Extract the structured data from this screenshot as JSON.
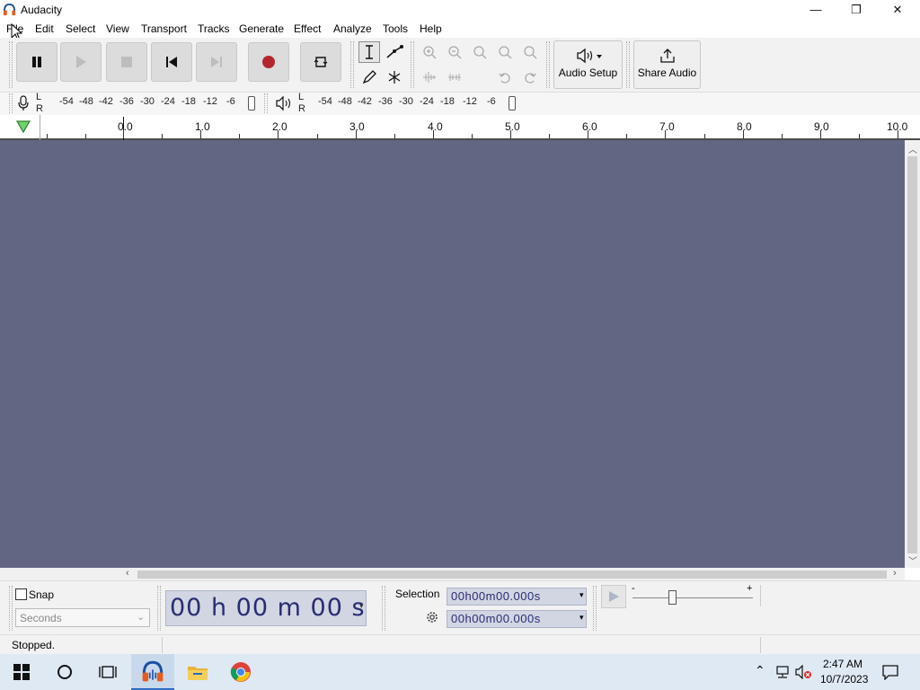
{
  "window": {
    "title": "Audacity",
    "minimize": "—",
    "maximize": "❐",
    "close": "✕"
  },
  "menu": [
    "File",
    "Edit",
    "Select",
    "View",
    "Transport",
    "Tracks",
    "Generate",
    "Effect",
    "Analyze",
    "Tools",
    "Help"
  ],
  "toolbar": {
    "audio_setup_label": "Audio Setup",
    "share_audio_label": "Share Audio"
  },
  "meters": {
    "record_lr": [
      "L",
      "R"
    ],
    "record_scale": [
      "-54",
      "-48",
      "-42",
      "-36",
      "-30",
      "-24",
      "-18",
      "-12",
      "-6"
    ],
    "play_lr": [
      "L",
      "R"
    ],
    "play_scale": [
      "-54",
      "-48",
      "-42",
      "-36",
      "-30",
      "-24",
      "-18",
      "-12",
      "-6"
    ]
  },
  "ruler": {
    "labels": [
      "0.0",
      "1.0",
      "2.0",
      "3.0",
      "4.0",
      "5.0",
      "6.0",
      "7.0",
      "8.0",
      "9.0",
      "10.0"
    ]
  },
  "snap": {
    "label": "Snap",
    "checked": false,
    "unit": "Seconds"
  },
  "time": {
    "h": "00",
    "h_unit": "h",
    "m": "00",
    "m_unit": "m",
    "s": "00",
    "s_unit": "s"
  },
  "selection": {
    "label": "Selection",
    "start": "00h00m00.000s",
    "end": "00h00m00.000s"
  },
  "play_speed": {
    "minus": "-",
    "plus": "+"
  },
  "status": {
    "text": "Stopped."
  },
  "taskbar": {
    "time": "2:47 AM",
    "date": "10/7/2023"
  },
  "colors": {
    "track_bg": "#636682",
    "record": "#b3262d",
    "taskbar": "#dfe9f4"
  }
}
